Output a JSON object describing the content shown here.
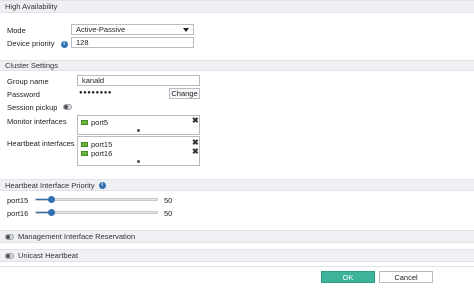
{
  "sections": {
    "high_availability": "High Availability",
    "cluster_settings": "Cluster Settings",
    "heartbeat_priority": "Heartbeat Interface Priority",
    "management_reservation": "Management Interface Reservation",
    "unicast_heartbeat": "Unicast Heartbeat"
  },
  "ha": {
    "mode_label": "Mode",
    "mode_value": "Active-Passive",
    "priority_label": "Device priority",
    "priority_value": "128"
  },
  "cluster": {
    "group_name_label": "Group name",
    "group_name_value": "kanald",
    "password_label": "Password",
    "password_value": "●●●●●●●●",
    "change_label": "Change",
    "session_pickup_label": "Session pickup",
    "session_pickup_on": false,
    "monitor_label": "Monitor interfaces",
    "monitor_items": [
      "port5"
    ],
    "heartbeat_label": "Heartbeat interfaces",
    "heartbeat_items": [
      "port15",
      "port16"
    ]
  },
  "priority": {
    "items": [
      {
        "name": "port15",
        "value": "50",
        "fraction": 0.12
      },
      {
        "name": "port16",
        "value": "50",
        "fraction": 0.12
      }
    ]
  },
  "toggles": {
    "management_on": false,
    "unicast_on": false
  },
  "footer": {
    "ok_label": "OK",
    "cancel_label": "Cancel"
  },
  "colors": {
    "accent": "#2f6fb3",
    "ok": "#3cb39a",
    "port": "#6db33f"
  },
  "icons": [
    "info-icon",
    "port-icon",
    "remove-icon",
    "chevron-down-icon",
    "toggle-icon"
  ]
}
